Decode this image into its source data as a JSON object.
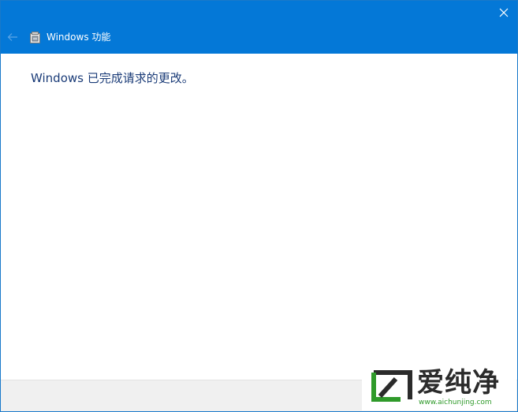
{
  "window": {
    "title": "Windows 功能",
    "message": "Windows 已完成请求的更改。",
    "icons": {
      "close": "close-icon",
      "back": "back-arrow-icon",
      "app": "windows-features-icon"
    }
  },
  "watermark": {
    "brand": "爱纯净",
    "url": "www.aichunjing.com"
  },
  "colors": {
    "titlebar": "#0478d7",
    "message_text": "#1b3c78",
    "footer": "#f0f0f0",
    "watermark_green": "#2f9a2a"
  }
}
